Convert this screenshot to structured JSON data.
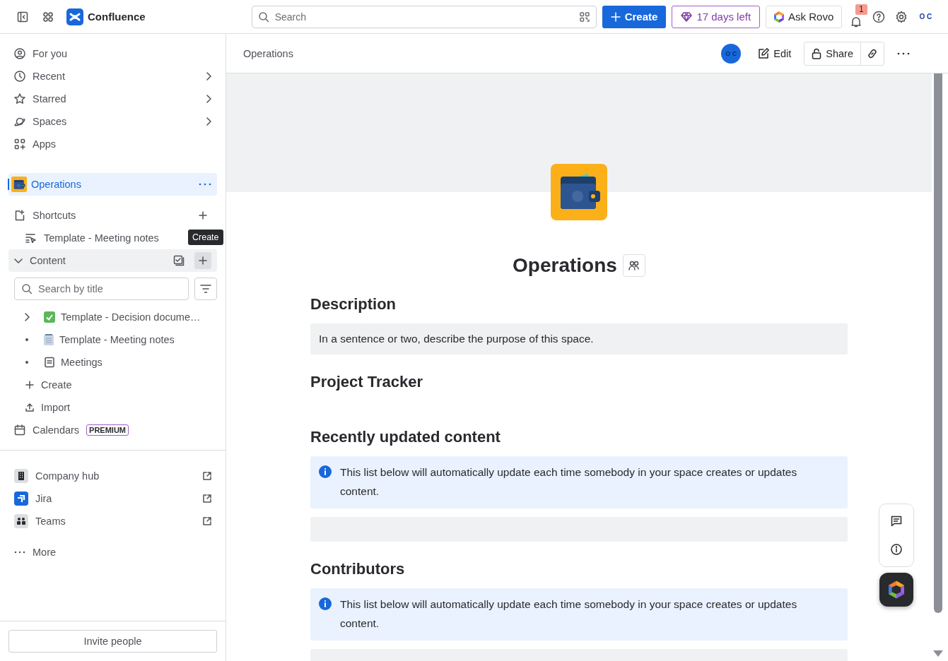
{
  "top_bar": {
    "product": "Confluence",
    "search": {
      "placeholder": "Search"
    },
    "create_button": "Create",
    "trial_button": "17 days left",
    "ask_button": "Ask Rovo",
    "notification_count": "1",
    "avatar": "O C"
  },
  "sidebar": {
    "nav": [
      {
        "kind": "person",
        "label": "For you",
        "submenu": false
      },
      {
        "kind": "clock",
        "label": "Recent",
        "submenu": true
      },
      {
        "kind": "star",
        "label": "Starred",
        "submenu": true
      },
      {
        "kind": "planet",
        "label": "Spaces",
        "submenu": true
      },
      {
        "kind": "apps",
        "label": "Apps",
        "submenu": false
      }
    ],
    "space": {
      "name": "Operations",
      "selected": true
    },
    "shortcuts": {
      "label": "Shortcuts",
      "items": [
        "Template - Meeting notes"
      ]
    },
    "tooltip": "Create",
    "content": {
      "label": "Content",
      "expanded": true,
      "search": {
        "placeholder": "Search by title"
      },
      "tree": [
        {
          "kind": "decision",
          "label": "Template - Decision docume…",
          "has_children": true
        },
        {
          "kind": "notes",
          "label": "Template - Meeting notes",
          "has_children": false
        },
        {
          "kind": "page",
          "label": "Meetings",
          "has_children": false
        }
      ],
      "actions": [
        {
          "kind": "create",
          "label": "Create"
        },
        {
          "kind": "import",
          "label": "Import"
        }
      ]
    },
    "calendars": {
      "label": "Calendars",
      "badge": "PREMIUM"
    },
    "apps": [
      {
        "kind": "hub",
        "label": "Company hub"
      },
      {
        "kind": "jira",
        "label": "Jira"
      },
      {
        "kind": "teams",
        "label": "Teams"
      }
    ],
    "more": "More",
    "invite_button": "Invite people"
  },
  "page": {
    "breadcrumb": "Operations",
    "avatar": "O C",
    "edit_button": "Edit",
    "share_button": "Share",
    "title": "Operations",
    "sections": [
      {
        "kind": "text",
        "heading": "Description",
        "body": "In a sentence or two, describe the purpose of this space."
      },
      {
        "kind": "heading",
        "heading": "Project Tracker"
      },
      {
        "kind": "info",
        "heading": "Recently updated content",
        "body": "This list below will automatically update each time somebody in your space creates or updates content."
      },
      {
        "kind": "info",
        "heading": "Contributors",
        "body": "This list below will automatically update each time somebody in your space creates or updates content."
      }
    ]
  }
}
